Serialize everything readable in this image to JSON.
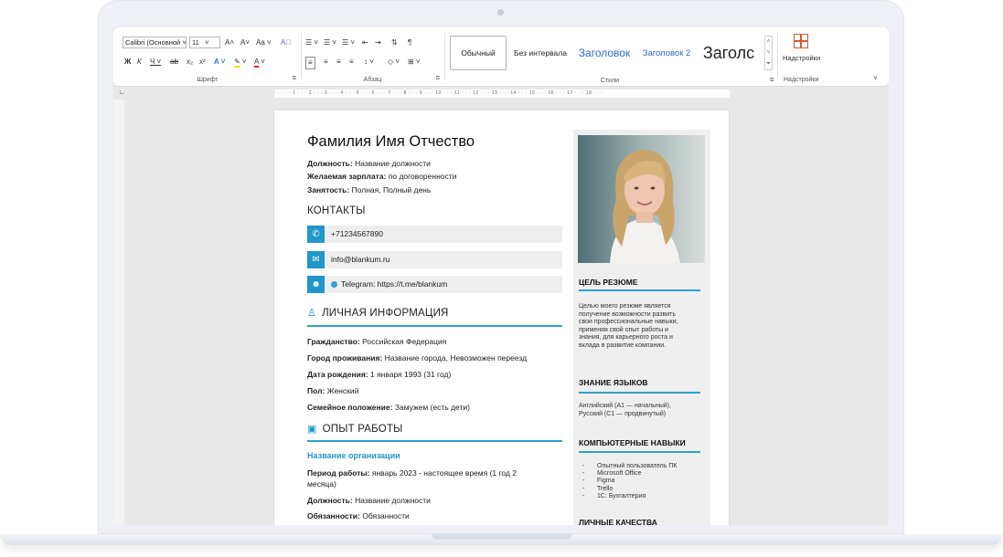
{
  "ribbon": {
    "font_name": "Calibri (Основной",
    "font_size": "11",
    "font_group_label": "Шрифт",
    "paragraph_group_label": "Абзац",
    "styles_group_label": "Стили",
    "addins_group_label": "Надстройки",
    "addins_button_label": "Надстройки",
    "grow_font": "A˄",
    "shrink_font": "A˅",
    "change_case": "Aa ˅",
    "bold": "Ж",
    "italic": "К",
    "underline": "Ч ˅",
    "strikethrough": "ab",
    "subscript": "x₂",
    "superscript": "x²",
    "pilcrow": "¶",
    "styles": [
      "Обычный",
      "Без интервала",
      "Заголовок",
      "Заголовок 2",
      "Заголс"
    ]
  },
  "ruler": {
    "text": "· · · · · 1 · · · 2 · · · 3 · · · 4 · · · 5 · · · 6 · · · 7 · · · 8 · · · 9 · · · 10 · · · 11 · · · 12 · · · 13 · · · 14 · · · 15 · · · 16 · · · 17 · · · 18 · · ·"
  },
  "resume": {
    "name": "Фамилия Имя Отчество",
    "position_label": "Должность:",
    "position_value": "Название должности",
    "salary_label": "Желаемая зарплата:",
    "salary_value": "по договоренности",
    "employment_label": "Занятость:",
    "employment_value": "Полная, Полный день",
    "contacts_title": "КОНТАКТЫ",
    "phone": "+71234567890",
    "email": "info@blankum.ru",
    "telegram": "Telegram: https://t.me/blankum",
    "personal_title": "ЛИЧНАЯ ИНФОРМАЦИЯ",
    "citizenship_label": "Гражданство:",
    "citizenship_value": "Российская Федерация",
    "city_label": "Город проживания:",
    "city_value": "Название города, Невозможен переезд",
    "birth_label": "Дата рождения:",
    "birth_value": "1 января 1993 (31 год)",
    "gender_label": "Пол:",
    "gender_value": "Женский",
    "family_label": "Семейное положение:",
    "family_value": "Замужем (есть дети)",
    "experience_title": "ОПЫТ РАБОТЫ",
    "org_name": "Название организации",
    "period_label": "Период работы:",
    "period_value_1": "январь 2023 - настоящее время (1 год 2",
    "period_value_2": "месяца)",
    "job_label": "Должность:",
    "job_value": "Название должности",
    "duties_label": "Обязанности:",
    "duties_value": "Обязанности"
  },
  "sidebar": {
    "goal_title": "ЦЕЛЬ РЕЗЮМЕ",
    "goal_lines": [
      "Целью моего резюме является",
      "получение возможности развить",
      "свои профессиональные навыки,",
      "применяя свой опыт работы и",
      "знания, для карьерного роста и",
      "вклада в развитие компании."
    ],
    "languages_title": "ЗНАНИЕ ЯЗЫКОВ",
    "languages_lines": [
      "Английский (A1 — начальный),",
      "Русский (C1 — продвинутый)"
    ],
    "skills_title": "КОМПЬЮТЕРНЫЕ НАВЫКИ",
    "skills": [
      "Опытный пользователь ПК",
      "Microsoft Office",
      "Figma",
      "Trello",
      "1С: Бухгалтерия"
    ],
    "qualities_title": "ЛИЧНЫЕ КАЧЕСТВА"
  },
  "colors": {
    "accent": "#2196c9",
    "rule": "#2ea3cf",
    "sidebar_bg": "#efefef"
  }
}
